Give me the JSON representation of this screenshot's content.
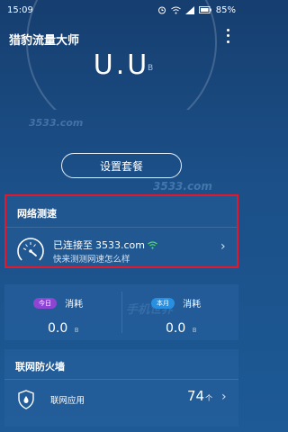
{
  "status_bar": {
    "time": "15:09",
    "battery": "85%"
  },
  "app": {
    "title": "猎豹流量大师"
  },
  "usage": {
    "value": "U.U",
    "unit": "B"
  },
  "setup_button": {
    "label": "设置套餐"
  },
  "speed_test": {
    "title": "网络测速",
    "connected_label": "已连接至",
    "network_name": "3533.com",
    "subtitle": "快来测测网速怎么样"
  },
  "consumption": {
    "today": {
      "tag": "今日",
      "label": "消耗",
      "value": "0.0",
      "unit": "B"
    },
    "month": {
      "tag": "本月",
      "label": "消耗",
      "value": "0.0",
      "unit": "B"
    }
  },
  "firewall": {
    "title": "联网防火墙",
    "item_label": "联网应用",
    "count": "74",
    "count_unit": "个"
  },
  "watermarks": {
    "small": "3533.com",
    "large": "3533.com",
    "side": "手机世界"
  },
  "colors": {
    "highlight_border": "#e5182b",
    "today_tag": "#8c46d2",
    "month_tag": "#2790e3",
    "wifi_green": "#4cd964"
  }
}
